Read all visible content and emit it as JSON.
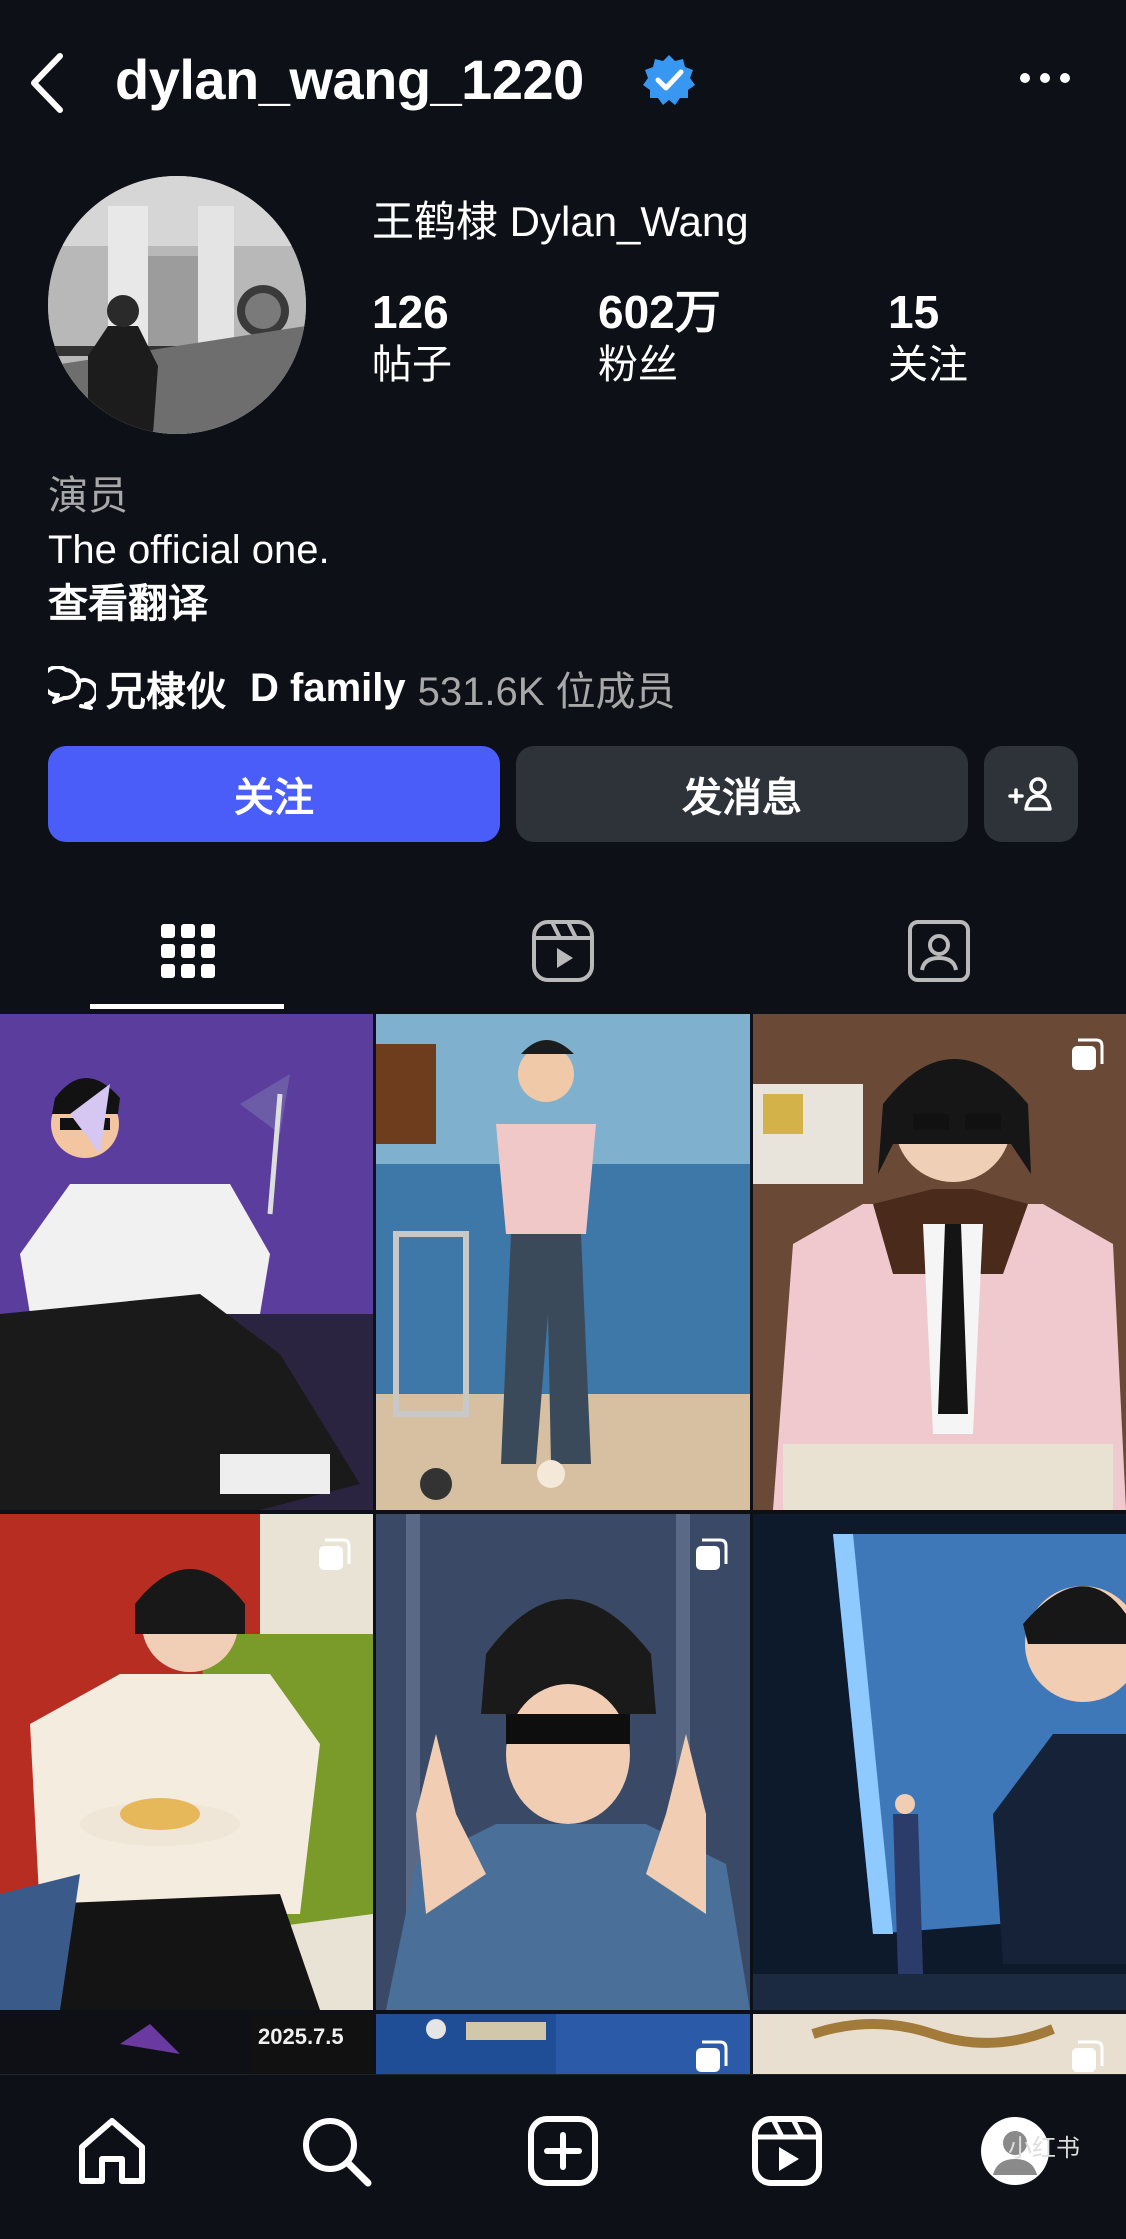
{
  "header": {
    "username": "dylan_wang_1220",
    "back_icon": "chevron-left-icon",
    "verified_icon": "verified-badge-icon",
    "more_icon": "more-horizontal-icon"
  },
  "profile": {
    "display_name": "王鹤棣 Dylan_Wang",
    "stats": {
      "posts": {
        "value": "126",
        "label": "帖子"
      },
      "followers": {
        "value": "602万",
        "label": "粉丝"
      },
      "following": {
        "value": "15",
        "label": "关注"
      }
    },
    "bio": {
      "category": "演员",
      "text": "The official one.",
      "translate": "查看翻译"
    },
    "community": {
      "icon": "chat-bubbles-icon",
      "name": "兄棣伙",
      "family": "D family",
      "count": "531.6K 位成员"
    }
  },
  "actions": {
    "follow_label": "关注",
    "message_label": "发消息",
    "suggest_icon": "add-person-icon"
  },
  "tabs": [
    "grid-icon",
    "reels-icon",
    "tagged-icon"
  ],
  "grid": {
    "caption_date": "2025.7.5"
  },
  "bottom_nav": [
    "home-icon",
    "search-icon",
    "create-icon",
    "reels-icon",
    "profile-icon"
  ],
  "watermark": "小红书",
  "colors": {
    "background": "#0d1117",
    "accent": "#4a5df9",
    "secondary_button": "#2e3339",
    "verified": "#3897f0",
    "muted_text": "#a8a8a8"
  }
}
